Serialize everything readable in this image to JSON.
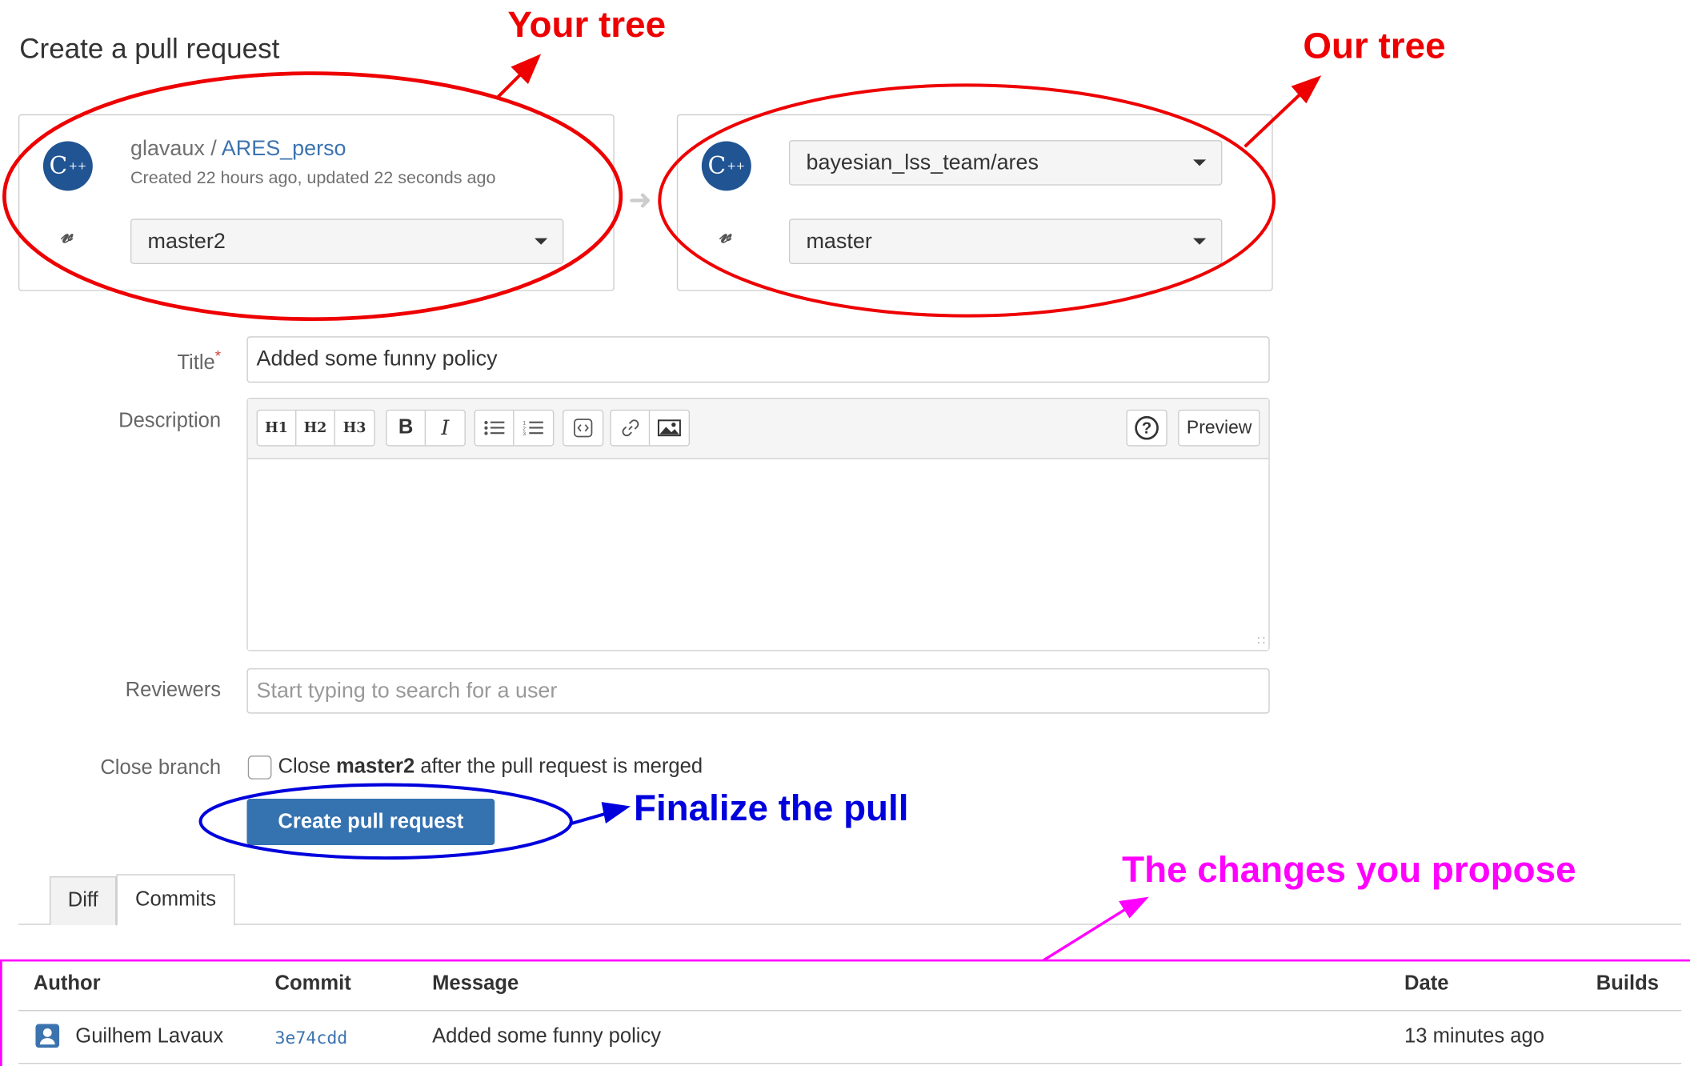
{
  "page_title": "Create a pull request",
  "source": {
    "owner": "glavaux",
    "separator": " / ",
    "repo": "ARES_perso",
    "meta": "Created 22 hours ago, updated 22 seconds ago",
    "branch": "master2"
  },
  "target": {
    "repo": "bayesian_lss_team/ares",
    "branch": "master"
  },
  "form": {
    "title_label": "Title",
    "title_required_mark": "*",
    "title_value": "Added some funny policy",
    "description_label": "Description",
    "toolbar": {
      "h1": "H1",
      "h2": "H2",
      "h3": "H3",
      "bold": "B",
      "italic": "I",
      "help": "?",
      "preview": "Preview"
    },
    "reviewers_label": "Reviewers",
    "reviewers_placeholder": "Start typing to search for a user",
    "close_branch_label": "Close branch",
    "close_prefix": "Close ",
    "close_branch_name": "master2",
    "close_suffix": " after the pull request is merged",
    "close_checked": false,
    "submit_label": "Create pull request"
  },
  "tabs": [
    {
      "label": "Diff",
      "active": false
    },
    {
      "label": "Commits",
      "active": true
    }
  ],
  "commits_table": {
    "headers": {
      "author": "Author",
      "commit": "Commit",
      "message": "Message",
      "date": "Date",
      "builds": "Builds"
    },
    "rows": [
      {
        "author": "Guilhem Lavaux",
        "commit": "3e74cdd",
        "message": "Added some funny policy",
        "date": "13 minutes ago",
        "builds": ""
      }
    ]
  },
  "annotations": {
    "your_tree": "Your tree",
    "our_tree": "Our tree",
    "finalize": "Finalize the pull",
    "changes": "The changes you propose"
  },
  "colors": {
    "annotation_red": "#ee0000",
    "annotation_blue": "#0000dd",
    "annotation_magenta": "#ff00ff",
    "primary_button": "#3572b0",
    "link": "#3b73af",
    "avatar": "#205493"
  }
}
